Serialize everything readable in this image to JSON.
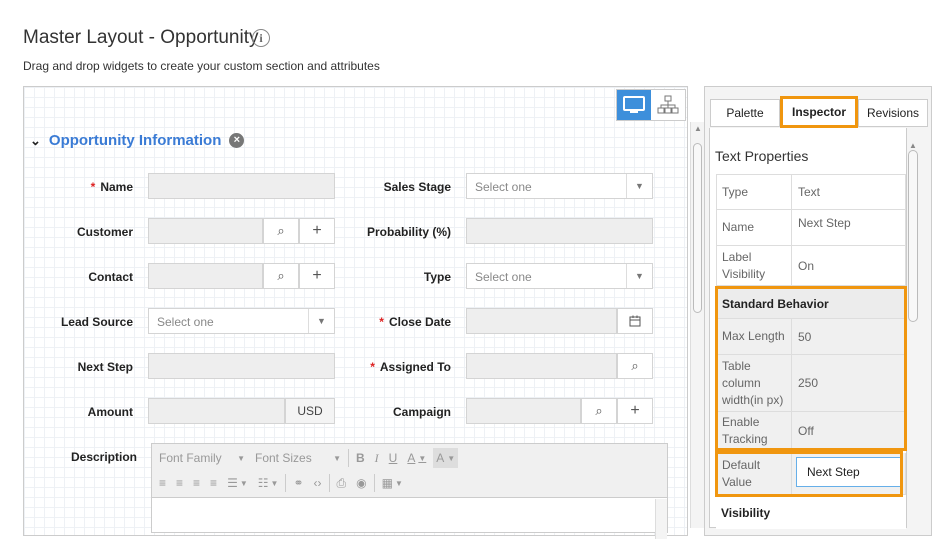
{
  "page": {
    "title": "Master Layout - Opportunity",
    "info_icon": "i",
    "subtitle": "Drag and drop widgets to create your custom section and attributes"
  },
  "section": {
    "title": "Opportunity Information",
    "remove_icon": "×"
  },
  "fields": {
    "name": "Name",
    "customer": "Customer",
    "contact": "Contact",
    "lead_source": "Lead Source",
    "lead_source_placeholder": "Select one",
    "next_step": "Next Step",
    "amount": "Amount",
    "currency": "USD",
    "description": "Description",
    "sales_stage": "Sales Stage",
    "sales_stage_placeholder": "Select one",
    "probability": "Probability (%)",
    "type": "Type",
    "type_placeholder": "Select one",
    "close_date": "Close Date",
    "assigned_to": "Assigned To",
    "campaign": "Campaign",
    "required_mark": "*"
  },
  "editor": {
    "font_family": "Font Family",
    "font_sizes": "Font Sizes"
  },
  "panel": {
    "tabs": [
      "Palette",
      "Inspector",
      "Revisions"
    ],
    "active_tab": "Inspector",
    "heading": "Text Properties",
    "rows": [
      {
        "key": "Type",
        "value": "Text"
      },
      {
        "key": "Name",
        "value": "Next Step"
      },
      {
        "key": "Label Visibility",
        "value": "On"
      }
    ],
    "standard_behavior": {
      "title": "Standard Behavior",
      "rows": [
        {
          "key": "Max Length",
          "value": "50"
        },
        {
          "key": "Table column width(in px)",
          "value": "250"
        },
        {
          "key": "Enable Tracking",
          "value": "Off"
        }
      ]
    },
    "default_value": {
      "key": "Default Value",
      "value": "Next Step"
    },
    "visibility_title": "Visibility"
  },
  "colors": {
    "accent": "#3a7bd5",
    "highlight": "#f0960f",
    "active_toggle": "#3d8fdb"
  }
}
